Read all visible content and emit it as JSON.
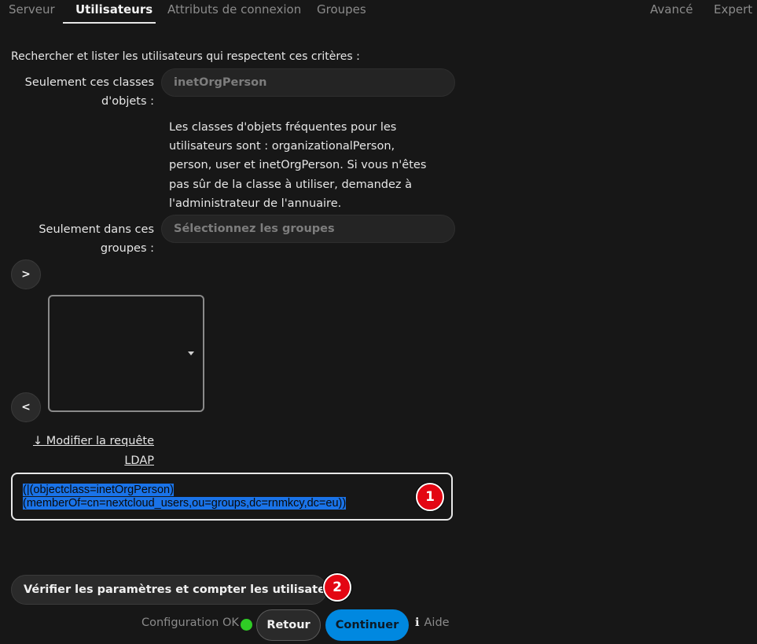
{
  "tabs": {
    "server": "Serveur",
    "users": "Utilisateurs",
    "login_attributes": "Attributs de connexion",
    "groups": "Groupes",
    "advanced": "Avancé",
    "expert": "Expert"
  },
  "intro": "Rechercher et lister les utilisateurs qui respectent ces critères :",
  "object_classes": {
    "label_line1": "Seulement ces classes",
    "label_line2": "d'objets :",
    "value": "inetOrgPerson",
    "hint": "Les classes d'objets fréquentes pour les utilisateurs sont : organizationalPerson, person, user et inetOrgPerson. Si vous n'êtes pas sûr de la classe à utiliser, demandez à l'administrateur de l'annuaire."
  },
  "groups_filter": {
    "label_line1": "Seulement dans ces",
    "label_line2": "groupes :",
    "placeholder": "Sélectionnez les groupes",
    "add_button": ">",
    "remove_button": "<"
  },
  "modify_query": {
    "line1": "↓ Modifier la requête",
    "line2": "LDAP"
  },
  "ldap_query": {
    "line1": "(|(objectclass=inetOrgPerson)",
    "line2": "(memberOf=cn=nextcloud_users,ou=groups,dc=rnmkcy,dc=eu))"
  },
  "annotations": {
    "badge1": "1",
    "badge2": "2"
  },
  "actions": {
    "verify": "Vérifier les paramètres et compter les utilisateurs",
    "status": "Configuration OK",
    "status_color": "#2fcc25",
    "back": "Retour",
    "continue": "Continuer",
    "help_icon": "info-icon",
    "help": "Aide"
  },
  "colors": {
    "accent": "#0088e0",
    "badge": "#e30613",
    "selection": "#1a73e8"
  }
}
